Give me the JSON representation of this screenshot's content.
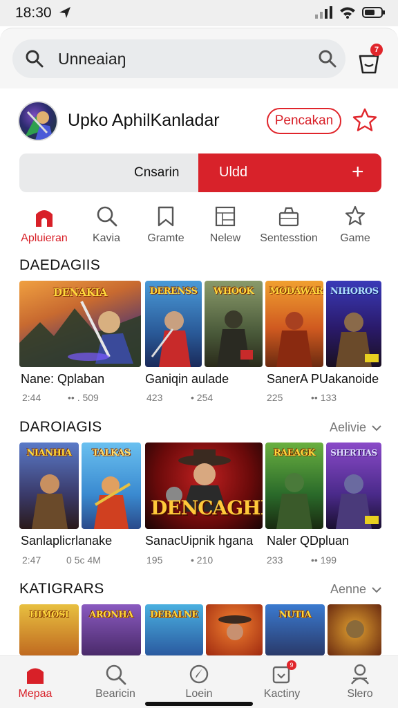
{
  "status_bar": {
    "time": "18:30"
  },
  "search": {
    "value": "Unneaiaŋ"
  },
  "cart": {
    "badge": "7"
  },
  "profile": {
    "name": "Upko AphilKanladar",
    "follow_label": "Pencakan"
  },
  "segmented": {
    "left_label": "Cnsarin",
    "right_label": "Uldd",
    "plus": "+"
  },
  "categories": [
    {
      "label": "Apluieran",
      "icon": "home-icon",
      "active": true
    },
    {
      "label": "Kavia",
      "icon": "search-icon"
    },
    {
      "label": "Gramte",
      "icon": "bookmark-icon"
    },
    {
      "label": "Nelew",
      "icon": "grid-icon"
    },
    {
      "label": "Sentesstion",
      "icon": "bag-icon"
    },
    {
      "label": "Game",
      "icon": "star-icon"
    }
  ],
  "sections": [
    {
      "title": "DAEDAGIIS",
      "more": "",
      "games": [
        {
          "name": "Nane: Qplaban",
          "stat_a": "2:44",
          "stat_b": "•• . 509",
          "card_titles": [
            "DENAKIA",
            "DERENSS",
            "WHOOK",
            "MODAWAR",
            "NIHOROS"
          ]
        },
        {
          "name": "Ganiqin aulade",
          "stat_a": "423",
          "stat_b": "• 254"
        },
        {
          "name": "SanerA PUakanoide",
          "stat_a": "225",
          "stat_b": "•• 133"
        }
      ]
    },
    {
      "title": "DAROIAGIS",
      "more": "Aelivie",
      "games": [
        {
          "name": "Sanlaplicrlanake",
          "stat_a": "2:47",
          "stat_b": "0 5c 4M",
          "card_titles": [
            "NIANHIA",
            "TALKAS",
            "DENCAGHIA",
            "RAEAGK",
            "SHERTIAS"
          ]
        },
        {
          "name": "SanacUipnik hgana",
          "stat_a": "195",
          "stat_b": "• 210"
        },
        {
          "name": "Naler QDpluan",
          "stat_a": "233",
          "stat_b": "•• 199"
        }
      ]
    },
    {
      "title": "KATIGRARS",
      "more": "Aenne",
      "card_titles": [
        "HIMOSI",
        "ARONHA",
        "DEBALNE",
        "",
        "NUTIA",
        ""
      ]
    }
  ],
  "bottom_nav": [
    {
      "label": "Mepaa",
      "icon": "home-icon",
      "active": true
    },
    {
      "label": "Bearicin",
      "icon": "search-icon"
    },
    {
      "label": "Loein",
      "icon": "compass-icon"
    },
    {
      "label": "Kactiny",
      "icon": "inbox-icon",
      "badge": "9"
    },
    {
      "label": "Slero",
      "icon": "user-icon"
    }
  ],
  "colors": {
    "accent": "#d8222a",
    "text": "#111111",
    "muted": "#777777"
  }
}
